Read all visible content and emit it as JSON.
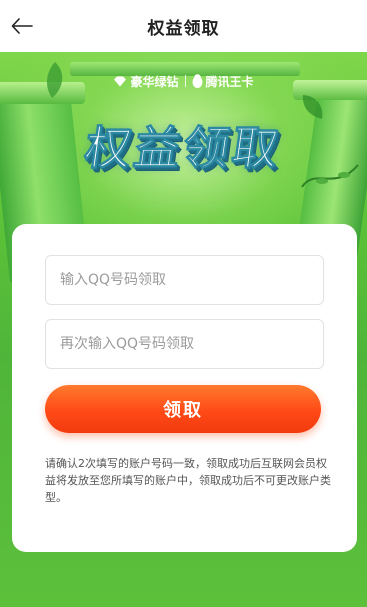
{
  "header": {
    "title": "权益领取",
    "back_icon": "arrow-left-icon"
  },
  "hero": {
    "brand_left": "豪华绿钻",
    "brand_left_icon": "diamond-icon",
    "brand_right": "腾讯王卡",
    "brand_right_icon": "penguin-icon",
    "title": "权益领取"
  },
  "form": {
    "qq_input_placeholder": "输入QQ号码领取",
    "qq_confirm_placeholder": "再次输入QQ号码领取",
    "qq_input_value": "",
    "qq_confirm_value": "",
    "submit_label": "领取",
    "notice": "请确认2次填写的账户号码一致，领取成功后互联网会员权益将发放至您所填写的账户中，领取成功后不可更改账户类型。"
  },
  "colors": {
    "accent": "#ff4a17",
    "hero_green": "#5cc238"
  }
}
